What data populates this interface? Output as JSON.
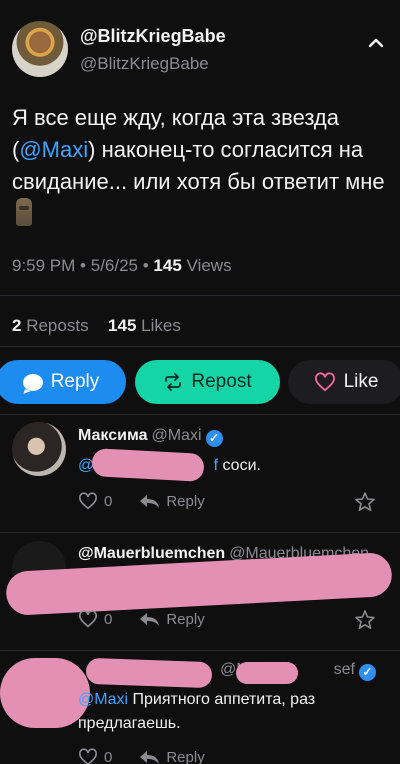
{
  "post": {
    "author_name": "@BlitzKriegBabe",
    "author_handle": "@BlitzKriegBabe",
    "text_before": "Я все еще жду, когда эта звезда (",
    "mention": "@Maxi",
    "text_after": ") наконец-то согласится на свидание... или хотя бы ответит мне",
    "time": "9:59 PM",
    "date": "5/6/25",
    "views_count": "145",
    "views_label": "Views",
    "reposts_count": "2",
    "reposts_label": "Reposts",
    "likes_count": "145",
    "likes_label": "Likes"
  },
  "actions": {
    "reply": "Reply",
    "repost": "Repost",
    "like": "Like"
  },
  "comments": [
    {
      "name": "Максима",
      "handle": "@Maxi",
      "verified": true,
      "mention_prefix": "@M",
      "suffix": "f",
      "text": "соси.",
      "like_count": "0",
      "reply_label": "Reply"
    },
    {
      "name": "@Mauerbluemchen",
      "handle": "@Mauerbluemchen",
      "like_count": "0",
      "reply_label": "Reply"
    },
    {
      "handle_fragment_start": "@M",
      "handle_fragment_end": "sef",
      "verified": true,
      "mention": "@Maxi",
      "text": "Приятного аппетита, раз предлагаешь.",
      "like_count": "0",
      "reply_label": "Reply"
    }
  ],
  "colors": {
    "background": "#0f0f10",
    "mention": "#3fa4ff",
    "reply_button": "#1d8cf0",
    "repost_button": "#15d4a6",
    "redaction": "#e490b4"
  }
}
